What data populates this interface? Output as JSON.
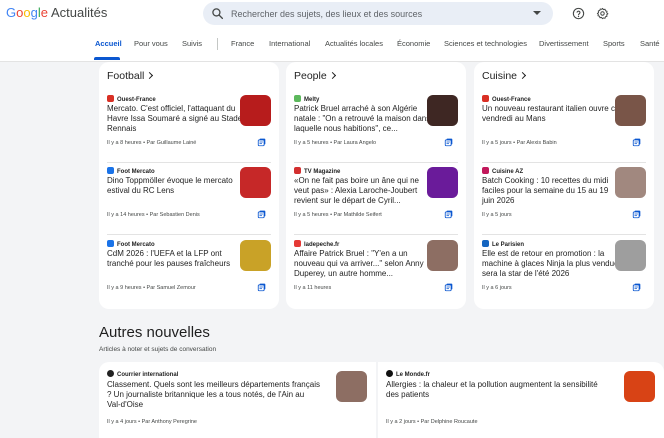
{
  "app": {
    "logo_google": "Google",
    "logo_actualites": "Actualités",
    "search_placeholder": "Rechercher des sujets, des lieux et des sources",
    "colors": {
      "brand_blue": "#4285F4",
      "brand_red": "#EA4335",
      "brand_yellow": "#FBBC05",
      "brand_green": "#34A853",
      "accent": "#0b57d0"
    }
  },
  "header_icons": [
    "search-icon",
    "dropdown-arrow-icon",
    "help-icon",
    "settings-gear-icon"
  ],
  "tabs": [
    {
      "label": "Accueil",
      "active": true
    },
    {
      "label": "Pour vous"
    },
    {
      "label": "Suivis"
    },
    {
      "label": "France"
    },
    {
      "label": "International"
    },
    {
      "label": "Actualités locales"
    },
    {
      "label": "Économie"
    },
    {
      "label": "Sciences et technologies"
    },
    {
      "label": "Divertissement"
    },
    {
      "label": "Sports"
    },
    {
      "label": "Santé"
    }
  ],
  "columns": [
    {
      "title": "Football",
      "stories": [
        {
          "source": "Ouest-France",
          "source_color": "#d93025",
          "headline": "Mercato. C'est officiel, l'attaquant du Havre Issa Soumaré a signé au Stade Rennais",
          "meta": "Il y a 8 heures • Par Guillaume Lainé",
          "thumb": "#b71c1c"
        },
        {
          "source": "Foot Mercato",
          "source_color": "#1a73e8",
          "headline": "Dino Toppmöller évoque le mercato estival du RC Lens",
          "meta": "Il y a 14 heures • Par Sebastien Denis",
          "thumb": "#c62828"
        },
        {
          "source": "Foot Mercato",
          "source_color": "#1a73e8",
          "headline": "CdM 2026 : l'UEFA et la LFP ont tranché pour les pauses fraîcheurs",
          "meta": "Il y a 9 heures • Par Samuel Zemour",
          "thumb": "#c9a227"
        }
      ]
    },
    {
      "title": "People",
      "stories": [
        {
          "source": "Melty",
          "source_color": "#5cb85c",
          "headline": "Patrick Bruel arraché à son Algérie natale : \"On a retrouvé la maison dans laquelle nous habitions\", ce...",
          "meta": "Il y a 5 heures • Par Laura Angelo",
          "thumb": "#3e2723"
        },
        {
          "source": "TV Magazine",
          "source_color": "#d32f2f",
          "headline": "«On ne fait pas boire un âne qui ne veut pas» : Alexia Laroche-Joubert revient sur le départ de Cyril...",
          "meta": "Il y a 5 heures • Par Mathilde Seifert",
          "thumb": "#6a1b9a"
        },
        {
          "source": "ladepeche.fr",
          "source_color": "#e53935",
          "headline": "Affaire Patrick Bruel : \"Y'en a un nouveau qui va arriver...\" selon Anny Duperey, un autre homme...",
          "meta": "Il y a 11 heures",
          "thumb": "#8d6e63"
        }
      ]
    },
    {
      "title": "Cuisine",
      "stories": [
        {
          "source": "Ouest-France",
          "source_color": "#d93025",
          "headline": "Un nouveau restaurant italien ouvre ce vendredi au Mans",
          "meta": "Il y a 5 jours • Par Alexis Babin",
          "thumb": "#795548"
        },
        {
          "source": "Cuisine AZ",
          "source_color": "#c2185b",
          "headline": "Batch Cooking : 10 recettes du midi faciles pour la semaine du 15 au 19 juin 2026",
          "meta": "Il y a 5 jours",
          "thumb": "#a1887f"
        },
        {
          "source": "Le Parisien",
          "source_color": "#1565c0",
          "headline": "Elle est de retour en promotion : la machine à glaces Ninja la plus vendue sera la star de l'été 2026",
          "meta": "Il y a 6 jours",
          "thumb": "#9e9e9e"
        }
      ]
    }
  ],
  "more_news": {
    "title": "Autres nouvelles",
    "subtitle": "Articles à noter et sujets de conversation",
    "stories": [
      {
        "source": "Courrier international",
        "source_color": "#222222",
        "headline": "Classement. Quels sont les meilleurs départements français ? Un journaliste britannique les a tous notés, de l'Ain au Val-d'Oise",
        "meta": "Il y a 4 jours • Par Anthony Peregrine",
        "thumb": "#8d6e63"
      },
      {
        "source": "Le Monde.fr",
        "source_color": "#111111",
        "headline": "Allergies : la chaleur et la pollution augmentent la sensibilité des patients",
        "meta": "Il y a 2 jours • Par Delphine Roucaute",
        "thumb": "#d84315"
      }
    ]
  }
}
